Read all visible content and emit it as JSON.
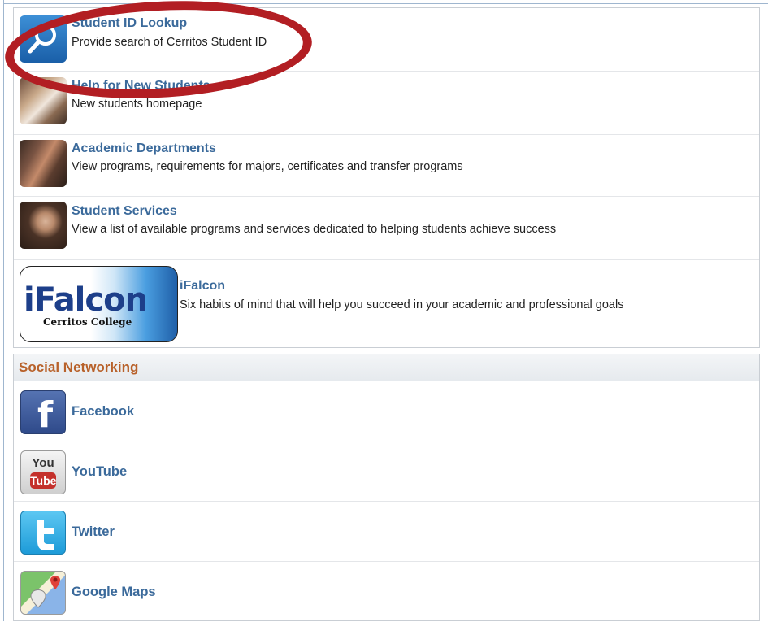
{
  "quick_links": [
    {
      "title": "Student ID Lookup",
      "description": "Provide search of Cerritos Student ID",
      "icon": "magnifier-icon"
    },
    {
      "title": "Help for New Students",
      "description": "New students homepage",
      "icon": "students-photo-icon"
    },
    {
      "title": "Academic Departments",
      "description": "View programs, requirements for majors, certificates and transfer programs",
      "icon": "students-group-photo-icon"
    },
    {
      "title": "Student Services",
      "description": "View a list of available programs and services dedicated to helping students achieve success",
      "icon": "student-portrait-icon"
    },
    {
      "title": "iFalcon",
      "description": "Six habits of mind that will help you succeed in your academic and professional goals",
      "icon": "ifalcon-logo"
    }
  ],
  "ifalcon_logo": {
    "brand": "iFalcon",
    "subtitle": "Cerritos College"
  },
  "social": {
    "header": "Social Networking",
    "items": [
      {
        "label": "Facebook",
        "icon": "facebook-icon",
        "color": "#3b5998"
      },
      {
        "label": "YouTube",
        "icon": "youtube-icon",
        "color": "#c4302b"
      },
      {
        "label": "Twitter",
        "icon": "twitter-icon",
        "color": "#2aa9e0"
      },
      {
        "label": "Google Maps",
        "icon": "google-maps-icon",
        "color": "#4caf50"
      }
    ],
    "youtube_glyph": {
      "top": "You",
      "bottom": "Tube"
    },
    "facebook_glyph": "f"
  },
  "annotation": {
    "color": "#b21e23"
  }
}
